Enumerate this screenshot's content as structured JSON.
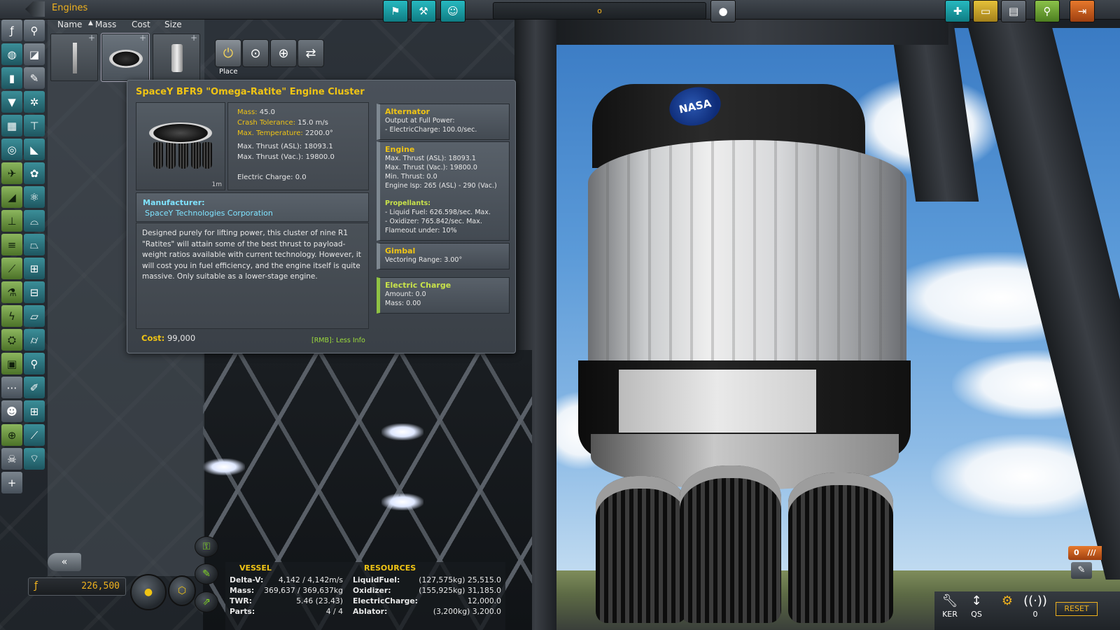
{
  "header": {
    "category_title": "Engines",
    "ship_name": "o",
    "center_buttons": [
      "agency-flag",
      "wrench-tools",
      "crew-portrait"
    ],
    "right_buttons": [
      "new-craft",
      "load-craft",
      "save-craft",
      "launch-pad",
      "exit"
    ]
  },
  "sort_bar": {
    "name": "Name",
    "mass": "Mass",
    "cost": "Cost",
    "size": "Size"
  },
  "tools": {
    "place_label": "Place"
  },
  "tooltip": {
    "title": "SpaceY BFR9 \"Omega-Ratite\" Engine Cluster",
    "size_tag": "1m",
    "stats": [
      {
        "label": "Mass:",
        "value": "45.0",
        "kind": "y"
      },
      {
        "label": "Crash Tolerance:",
        "value": "15.0 m/s",
        "kind": "y"
      },
      {
        "label": "Max. Temperature:",
        "value": "2200.0°",
        "kind": "y"
      },
      {
        "label": "Max. Thrust (ASL):",
        "value": "18093.1",
        "kind": "w"
      },
      {
        "label": "Max. Thrust (Vac.):",
        "value": "19800.0",
        "kind": "w"
      },
      {
        "label": "Electric Charge:",
        "value": "0.0",
        "kind": "w"
      }
    ],
    "manufacturer_label": "Manufacturer:",
    "manufacturer": "SpaceY Technologies Corporation",
    "description": "Designed purely for lifting power, this cluster of nine R1 \"Ratites\" will attain some of the best thrust to payload-weight ratios available with current technology. However, it will cost you in fuel efficiency, and the engine itself is quite massive. Only suitable as a lower-stage engine.",
    "cost_label": "Cost:",
    "cost_value": "99,000",
    "less_info": "[RMB]: Less Info",
    "modules": [
      {
        "title": "Alternator",
        "lines": [
          "Output at Full Power:",
          "- ElectricCharge: 100.0/sec."
        ]
      },
      {
        "title": "Engine",
        "lines": [
          "Max. Thrust (ASL): 18093.1",
          "Max. Thrust (Vac.): 19800.0",
          "Min. Thrust: 0.0",
          "Engine Isp: 265 (ASL) - 290 (Vac.)"
        ],
        "sub_title": "Propellants:",
        "sub_lines": [
          "- Liquid Fuel: 626.598/sec. Max.",
          "- Oxidizer: 765.842/sec. Max.",
          "Flameout under: 10%"
        ]
      },
      {
        "title": "Gimbal",
        "lines": [
          "Vectoring Range: 3.00°"
        ]
      },
      {
        "title": "Electric Charge",
        "lines": [
          "Amount: 0.0",
          "Mass: 0.00"
        ]
      }
    ]
  },
  "funds": {
    "value": "226,500"
  },
  "engineer_info": {
    "vessel_header": "VESSEL",
    "resources_header": "RESOURCES",
    "vessel": [
      {
        "label": "Delta-V:",
        "value": "4,142 / 4,142m/s"
      },
      {
        "label": "Mass:",
        "value": "369,637 / 369,637kg"
      },
      {
        "label": "TWR:",
        "value": "5.46 (23.43)"
      },
      {
        "label": "Parts:",
        "value": "4 / 4"
      }
    ],
    "resources": [
      {
        "label": "LiquidFuel:",
        "value": "(127,575kg) 25,515.0"
      },
      {
        "label": "Oxidizer:",
        "value": "(155,925kg) 31,185.0"
      },
      {
        "label": "ElectricCharge:",
        "value": "12,000.0"
      },
      {
        "label": "Ablator:",
        "value": "(3,200kg) 3,200.0"
      }
    ]
  },
  "bottom_right": {
    "ker_label": "KER",
    "qs_label": "QS",
    "signal_count": "0",
    "crew_count": "0",
    "reset_label": "RESET"
  },
  "rocket": {
    "logo_text": "NASA"
  }
}
